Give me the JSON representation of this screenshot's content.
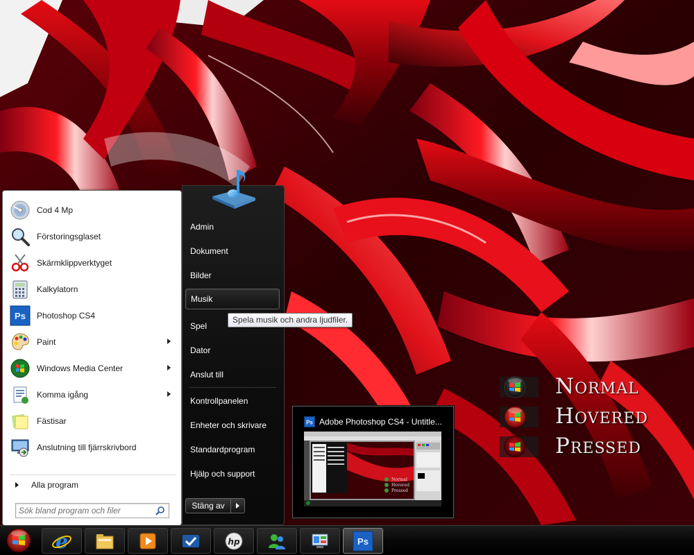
{
  "start_menu": {
    "programs": [
      {
        "label": "Cod 4 Mp",
        "icon": "disc-icon",
        "submenu": false
      },
      {
        "label": "Förstoringsglaset",
        "icon": "magnifier-icon",
        "submenu": false
      },
      {
        "label": "Skärmklippverktyget",
        "icon": "scissors-icon",
        "submenu": false
      },
      {
        "label": "Kalkylatorn",
        "icon": "calculator-icon",
        "submenu": false
      },
      {
        "label": "Photoshop CS4",
        "icon": "photoshop-icon",
        "submenu": false
      },
      {
        "label": "Paint",
        "icon": "paint-palette-icon",
        "submenu": true
      },
      {
        "label": "Windows Media Center",
        "icon": "media-center-icon",
        "submenu": true
      },
      {
        "label": "Komma igång",
        "icon": "getting-started-icon",
        "submenu": true
      },
      {
        "label": "Fästisar",
        "icon": "sticky-notes-icon",
        "submenu": false
      },
      {
        "label": "Anslutning till fjärrskrivbord",
        "icon": "remote-desktop-icon",
        "submenu": false
      }
    ],
    "all_programs": "Alla program",
    "search_placeholder": "Sök bland program och filer",
    "right_items": [
      {
        "label": "Admin"
      },
      {
        "label": "Dokument"
      },
      {
        "label": "Bilder"
      },
      {
        "label": "Musik",
        "hovered": true
      },
      {
        "label": "Spel"
      },
      {
        "label": "Dator"
      },
      {
        "label": "Anslut till"
      },
      {
        "label": "Kontrollpanelen"
      },
      {
        "label": "Enheter och skrivare"
      },
      {
        "label": "Standardprogram"
      },
      {
        "label": "Hjälp och support"
      }
    ],
    "shutdown_label": "Stäng av",
    "tooltip": "Spela musik och andra ljudfiler."
  },
  "thumbnail": {
    "title": "Adobe Photoshop CS4 - Untitle...",
    "preview_legend": [
      "Normal",
      "Hovered",
      "Pressed"
    ]
  },
  "orb_legend": [
    "Normal",
    "Hovered",
    "Pressed"
  ],
  "taskbar": {
    "buttons": [
      {
        "name": "internet-explorer-icon",
        "active": false
      },
      {
        "name": "file-explorer-icon",
        "active": false
      },
      {
        "name": "media-player-icon",
        "active": false
      },
      {
        "name": "checkmark-app-icon",
        "active": false
      },
      {
        "name": "hp-icon",
        "active": false
      },
      {
        "name": "messenger-icon",
        "active": false
      },
      {
        "name": "control-panel-icon",
        "active": false
      },
      {
        "name": "photoshop-icon",
        "active": true
      }
    ]
  },
  "colors": {
    "accent": "#c4000d",
    "photoshop_blue": "#1a62c4"
  }
}
